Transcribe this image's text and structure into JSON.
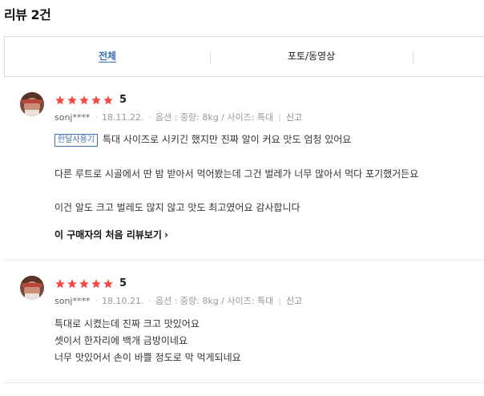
{
  "header": {
    "title": "리뷰 2건"
  },
  "tabs": [
    {
      "label": "전체"
    },
    {
      "label": "포토/동영상"
    }
  ],
  "reviews": [
    {
      "rating": "5",
      "stars_filled": 5,
      "user": "sonj****",
      "date": "18.11.22.",
      "option": "옵션 : 중량: 8kg / 사이즈: 특대",
      "report": "신고",
      "badge": "한달사용기",
      "lines": [
        "특대 사이즈로 시키긴 했지만  진짜 알이 커요    맛도 엄청 있어요",
        "다른 루트로 시골에서 딴 밤 받아서 먹어봤는데    그건 벌레가 너무 많아서  먹다 포기했거든요",
        "이건  알도 크고  벌레도  많지 않고    맛도 최고였어요    감사합니다"
      ],
      "first_review_link": "이 구매자의 처음 리뷰보기"
    },
    {
      "rating": "5",
      "stars_filled": 5,
      "user": "sonj****",
      "date": "18.10.21.",
      "option": "옵션 : 중량: 8kg / 사이즈: 특대",
      "report": "신고",
      "lines": [
        "특대로 시켰는데    진짜 크고 맛있어요",
        "셋이서 한자리에 백개 금방이네요",
        "너무 맛있어서  손이 바쁠 정도로  막 먹게되네요"
      ]
    }
  ],
  "colors": {
    "star": "#f24b43",
    "accent": "#3a6fb8"
  },
  "icons": {
    "star": "star-icon",
    "chevron": "chevron-right-icon"
  }
}
